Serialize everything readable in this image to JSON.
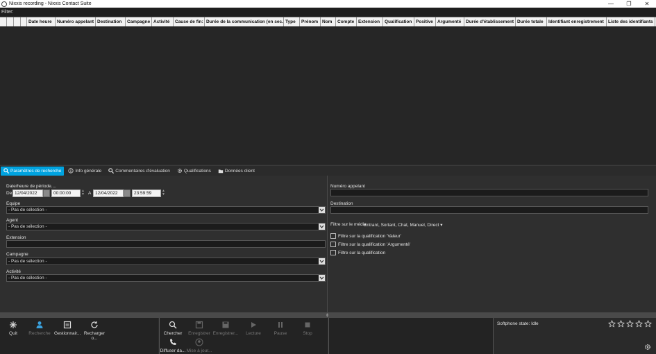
{
  "window": {
    "title": "Nixxis recording - Nixxis Contact Suite",
    "minimize": "—",
    "restore": "❐",
    "close": "✕"
  },
  "filter": {
    "label": "Filter:"
  },
  "grid": {
    "columns": [
      "Date heure",
      "Numéro appelant",
      "Destination",
      "Campagne",
      "Activité",
      "Cause de fin:",
      "Durée de la communication (en sec.)",
      "Type",
      "Prénom",
      "Nom",
      "Compte",
      "Extension",
      "Qualification",
      "Positive",
      "Argumenté",
      "Durée d'établissement",
      "Durée totale",
      "Identifiant enregistrement",
      "Liste des identifiants"
    ]
  },
  "tabs": [
    {
      "label": "Paramètres de recherche",
      "icon": "search-icon",
      "active": true
    },
    {
      "label": "Info générale",
      "icon": "info-icon",
      "active": false
    },
    {
      "label": "Commentaires d'évaluation",
      "icon": "search-icon",
      "active": false
    },
    {
      "label": "Qualifications",
      "icon": "gear-icon",
      "active": false
    },
    {
      "label": "Données client",
      "icon": "folder-icon",
      "active": false
    }
  ],
  "search": {
    "period_label": "Date/heure de période....",
    "from_label": "De",
    "to_label": "A",
    "from_date": "12/04/2022",
    "from_time": "00:00:00",
    "to_date": "12/04/2022",
    "to_time": "23:59:59",
    "team_label": "Equipe",
    "team_value": "- Pas de sélection -",
    "agent_label": "Agent",
    "agent_value": "- Pas de sélection -",
    "extension_label": "Extension",
    "extension_value": "",
    "campaign_label": "Campagne",
    "campaign_value": "- Pas de sélection -",
    "activity_label": "Activité",
    "activity_value": "- Pas de sélection -",
    "caller_label": "Numéro appelant",
    "caller_value": "",
    "destination_label": "Destination",
    "destination_value": "",
    "media_filter_label": "Filtre sur le média",
    "media_filter_value": "Entrant, Sortant, Chat, Manuel, Direct",
    "qual_value_label": "Filtre sur la qualification 'Valeur'",
    "qual_argued_label": "Filtre sur la qualification 'Argumenté'",
    "qual_label": "Filtre sur la qualification"
  },
  "toolbar": {
    "quit": "Quit",
    "search_agent": "Recherche",
    "manager": "Gestionnair...",
    "reload": "Recharger o...",
    "find": "Chercher",
    "save": "Enregistrer",
    "save_as": "Enregistrer...",
    "play": "Lecture",
    "pause": "Pause",
    "stop": "Stop",
    "broadcast": "Diffuser da...",
    "update": "Mise à jour..."
  },
  "softphone": {
    "state": "Softphone state: Idle",
    "rating_stars": 5
  },
  "colors": {
    "accent": "#00a3e0",
    "background": "#2d2d2d"
  }
}
